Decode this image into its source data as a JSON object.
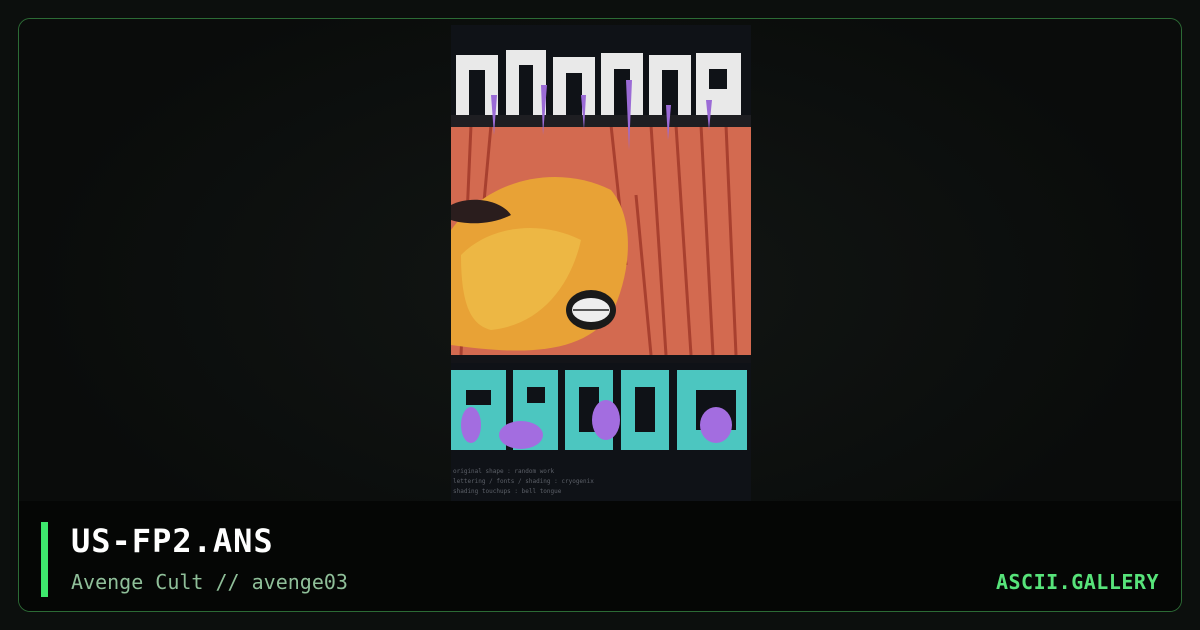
{
  "artwork": {
    "filename": "US-FP2.ANS",
    "byline": "Avenge Cult // avenge03",
    "credits": [
      "original shape : random work",
      "lettering / fonts / shading : cryogenix",
      "shading touchups : bell tongue"
    ]
  },
  "brand": {
    "label": "ASCII.GALLERY"
  },
  "colors": {
    "accent": "#3ee86d",
    "border": "#2c6b35",
    "brand": "#57e37a",
    "byline": "#8fbf99"
  }
}
